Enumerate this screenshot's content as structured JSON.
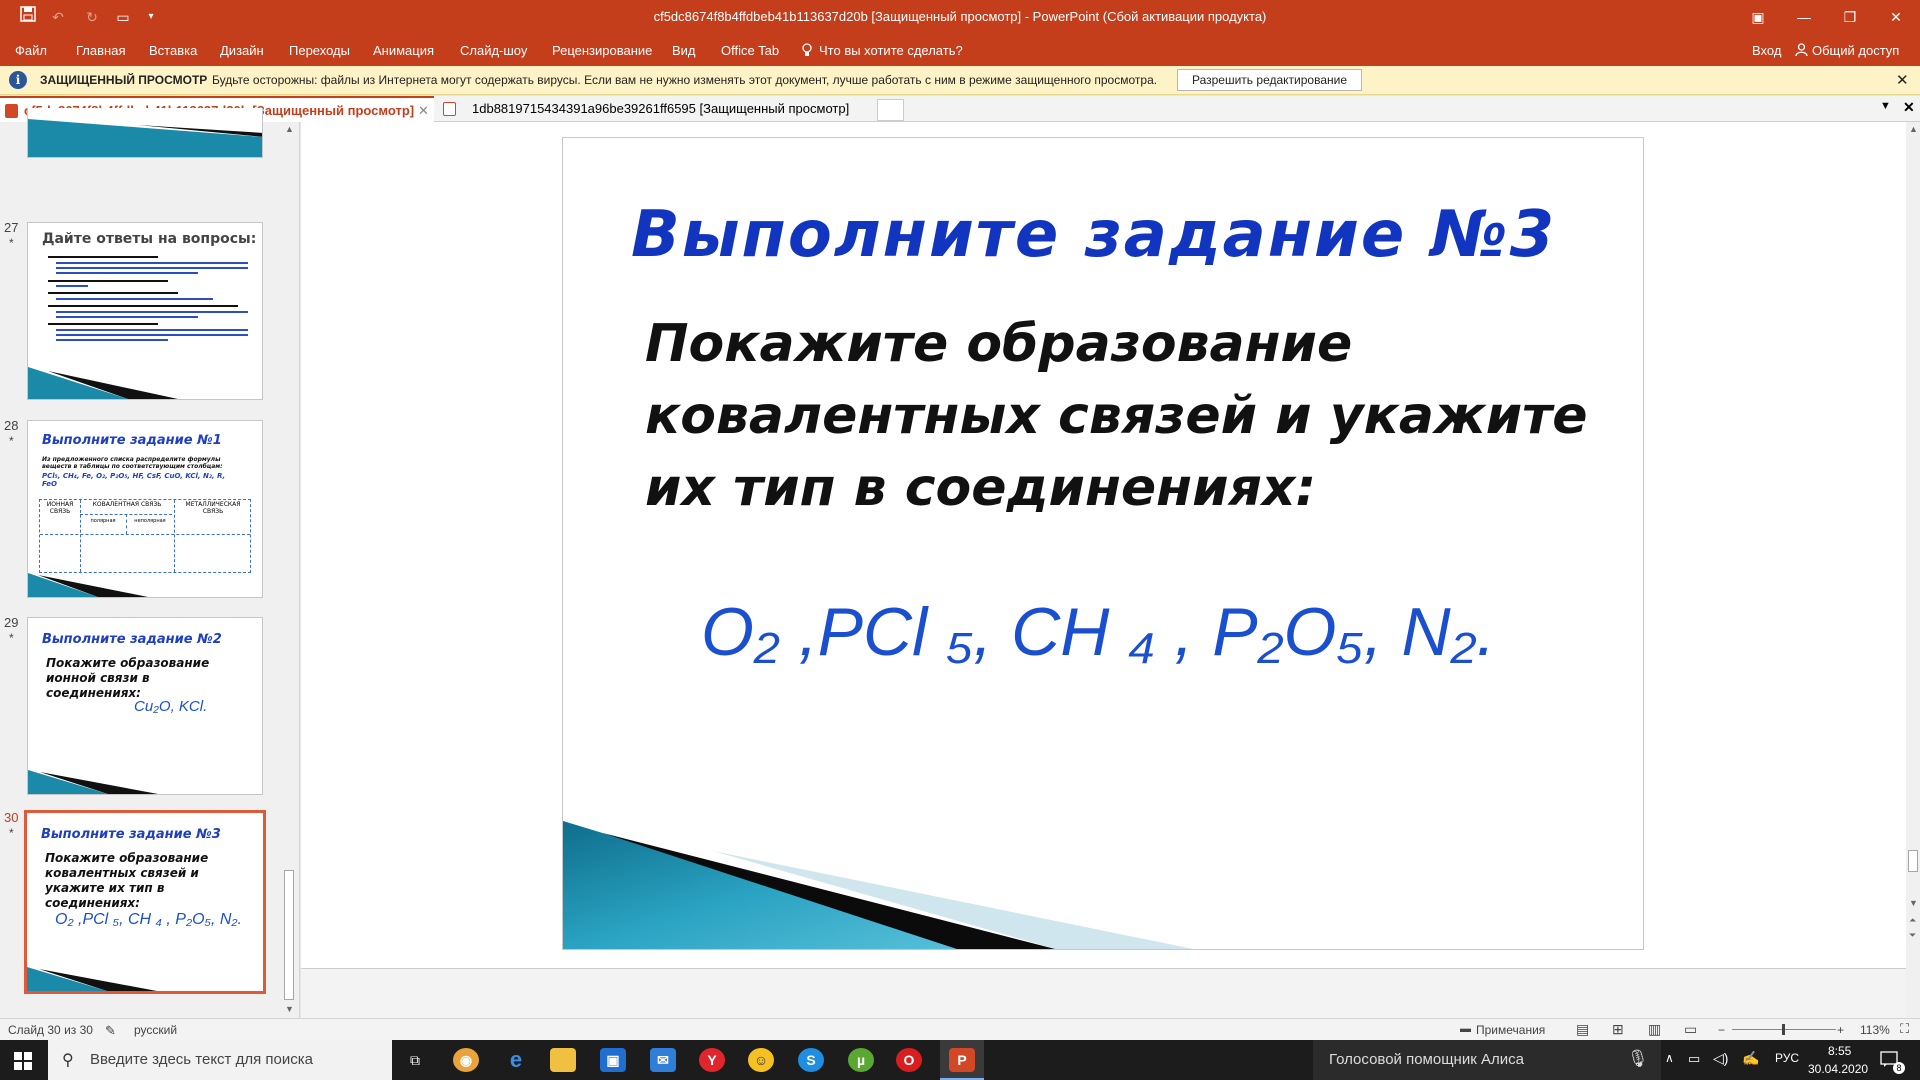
{
  "titlebar": {
    "title": "cf5dc8674f8b4ffdbeb41b113637d20b [Защищенный просмотр] - PowerPoint (Сбой активации продукта)",
    "save_icon": "save-icon",
    "window_controls": [
      "ribbon-display-options",
      "minimize",
      "restore",
      "close"
    ]
  },
  "ribbon": {
    "tabs": [
      "Файл",
      "Главная",
      "Вставка",
      "Дизайн",
      "Переходы",
      "Анимация",
      "Слайд-шоу",
      "Рецензирование",
      "Вид",
      "Office Tab"
    ],
    "tell_me": "Что вы хотите сделать?",
    "signin": "Вход",
    "share": "Общий доступ"
  },
  "protected_view": {
    "title": "ЗАЩИЩЕННЫЙ ПРОСМОТР",
    "message": "Будьте осторожны: файлы из Интернета могут содержать вирусы. Если вам не нужно изменять этот документ, лучше работать с ним в режиме защищенного просмотра.",
    "enable_button": "Разрешить редактирование"
  },
  "doc_tabs": [
    {
      "label": "cf5dc8674f8b4ffdbeb41b113637d20b [Защищенный просмотр]",
      "active": true
    },
    {
      "label": "1db8819715434391a96be39261ff6595 [Защищенный просмотр]",
      "active": false
    }
  ],
  "thumbnails": [
    {
      "number": "27",
      "star": "*",
      "title": "Дайте ответы на вопросы:"
    },
    {
      "number": "28",
      "star": "*",
      "title": "Выполните задание №1",
      "text": "Из предложенного списка распределите формулы веществ в таблицы по соответствующим столбцам:",
      "formula": "PCl₅, CH₄, Fe, O₂, P₂O₅, HF, CsF, CuO, KCl, N₂, R, FeO",
      "table_headers": [
        "ИОННАЯ СВЯЗЬ",
        "КОВАЛЕНТНАЯ СВЯЗЬ",
        "МЕТАЛЛИЧЕСКАЯ СВЯЗЬ"
      ],
      "sub_headers": [
        "полярная",
        "неполярная"
      ]
    },
    {
      "number": "29",
      "star": "*",
      "title": "Выполните задание №2",
      "text": "Покажите образование ионной связи в соединениях:",
      "formula": "Cu₂O,  KCl."
    },
    {
      "number": "30",
      "star": "*",
      "title": "Выполните задание №3",
      "text": "Покажите образование ковалентных связей и укажите их тип в соединениях:",
      "formula": "O₂ ,PCl ₅, CH ₄ , P₂O₅, N₂."
    }
  ],
  "slide": {
    "title": "Выполните задание №3",
    "body_lines": [
      "Покажите образование",
      "ковалентных связей и укажите",
      "их тип в соединениях:"
    ],
    "formula": "O₂ ,PCl ₅, CH ₄ , P₂O₅, N₂."
  },
  "statusbar": {
    "slide_info": "Слайд 30 из 30",
    "language": "русский",
    "notes": "Примечания",
    "zoom": "113%"
  },
  "taskbar": {
    "search_placeholder": "Введите здесь текст для поиска",
    "alice": "Голосовой помощник Алиса",
    "lang": "РУС",
    "time": "8:55",
    "date": "30.04.2020",
    "notifications": "8"
  }
}
